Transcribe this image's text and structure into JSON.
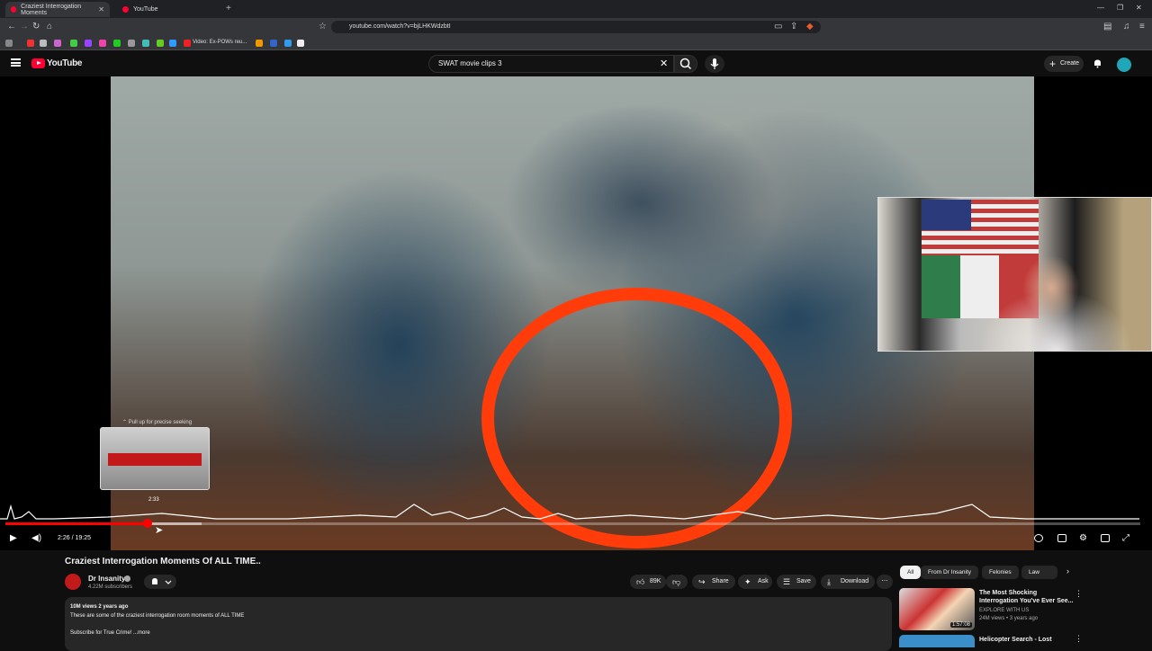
{
  "browser": {
    "tabs": [
      {
        "title": "Craziest Interrogation Moments",
        "active": true
      },
      {
        "title": "YouTube",
        "active": false
      }
    ],
    "url": "youtube.com/watch?v=bjLHKWdzbtI",
    "bookmark_label": "Video: Ex-POWs reu..."
  },
  "header": {
    "brand": "YouTube",
    "search_query": "SWAT movie clips  3",
    "create_label": "Create",
    "accent_color": "#ff0033"
  },
  "player": {
    "time_current": "2:26",
    "time_total": "19:25",
    "time_display": "2:26 / 19:25",
    "progress_fraction": 0.125,
    "buffer_fraction": 0.173,
    "seek_hint": "Pull up for precise seeking",
    "seek_preview_time": "2:33"
  },
  "video": {
    "title": "Craziest Interrogation Moments Of ALL TIME..",
    "channel": "Dr Insanity",
    "subscribers": "4.22M subscribers",
    "likes": "89K",
    "actions": {
      "share": "Share",
      "ask": "Ask",
      "save": "Save",
      "download": "Download"
    },
    "description": {
      "meta": "10M views  2 years ago",
      "line1": "These are some of the craziest interrogation room moments of ALL TIME",
      "line2": "Subscribe for True Crime!  ...more"
    }
  },
  "sidebar": {
    "chips": [
      "All",
      "From Dr Insanity",
      "Felonies",
      "Law enfor"
    ],
    "recommendations": [
      {
        "title": "The Most Shocking Interrogation You've Ever See...",
        "channel": "EXPLORE WITH US",
        "meta": "24M views • 3 years ago",
        "duration": "1:57:08"
      },
      {
        "title": "Helicopter Search - Lost",
        "channel": "",
        "meta": "",
        "duration": ""
      }
    ]
  }
}
